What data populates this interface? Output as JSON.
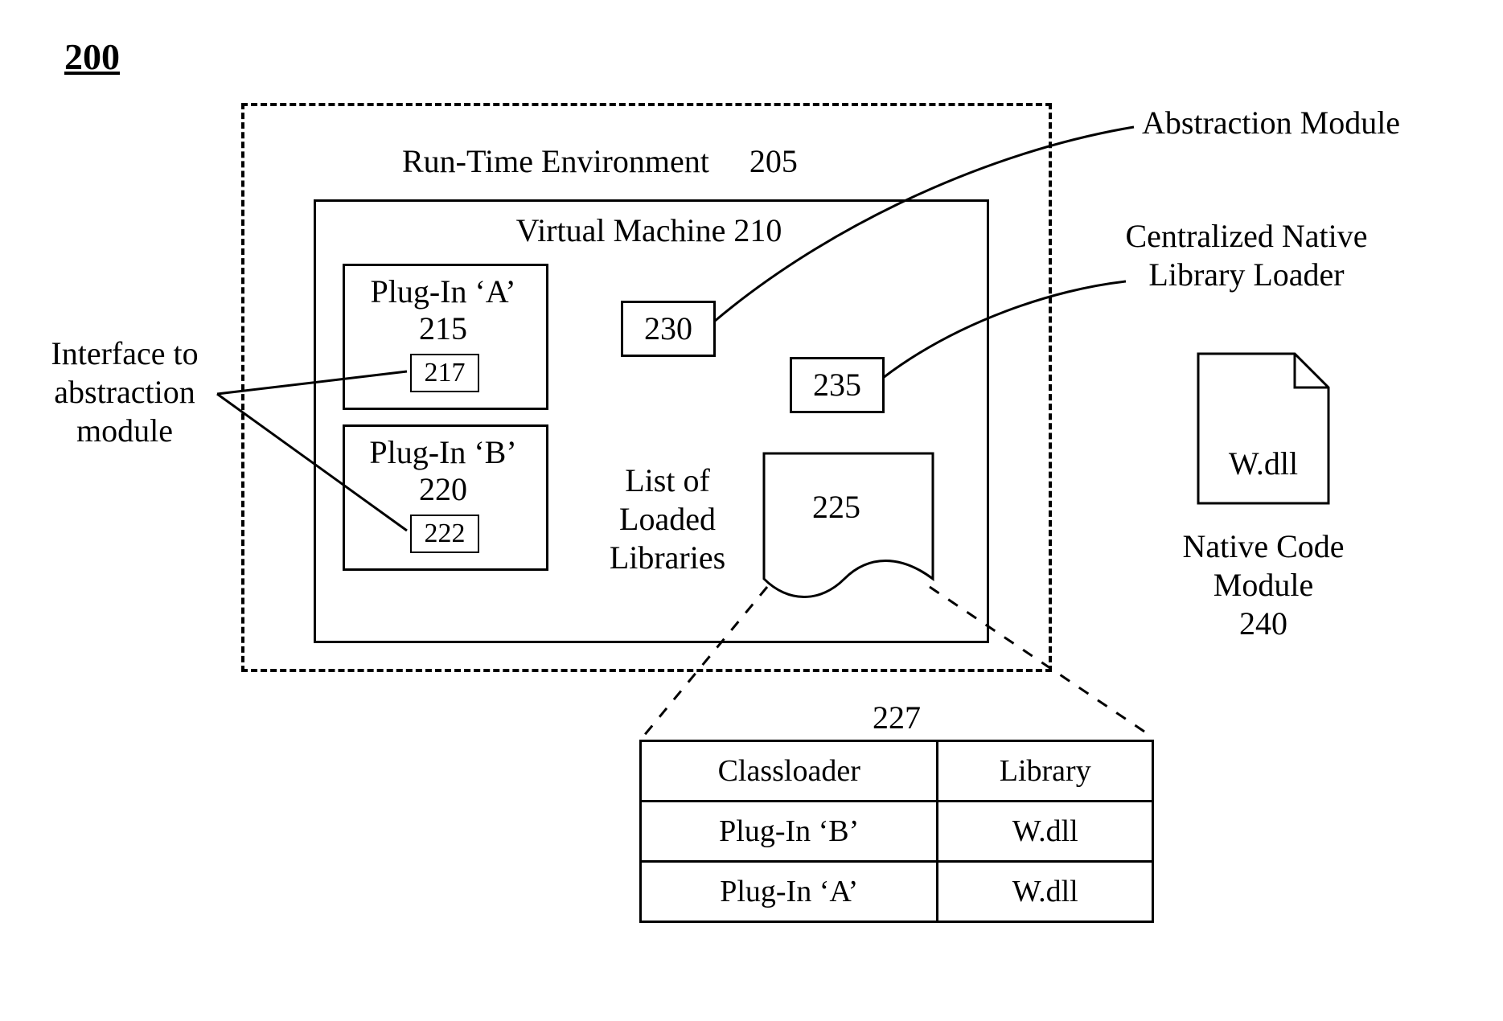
{
  "figure_number": "200",
  "runtime_env": {
    "label": "Run-Time Environment",
    "ref": "205"
  },
  "vm": {
    "label": "Virtual Machine",
    "ref": "210"
  },
  "plugin_a": {
    "label": "Plug-In ‘A’",
    "ref": "215",
    "inner_ref": "217"
  },
  "plugin_b": {
    "label": "Plug-In ‘B’",
    "ref": "220",
    "inner_ref": "222"
  },
  "box_230": "230",
  "box_235": "235",
  "box_225": "225",
  "list_label_l1": "List of",
  "list_label_l2": "Loaded",
  "list_label_l3": "Libraries",
  "table_ref": "227",
  "table": {
    "h1": "Classloader",
    "h2": "Library",
    "r1c1": "Plug-In ‘B’",
    "r1c2": "W.dll",
    "r2c1": "Plug-In ‘A’",
    "r2c2": "W.dll"
  },
  "callout_left_l1": "Interface to",
  "callout_left_l2": "abstraction",
  "callout_left_l3": "module",
  "callout_top_right": "Abstraction Module",
  "callout_mid_right_l1": "Centralized Native",
  "callout_mid_right_l2": "Library Loader",
  "file_label": "W.dll",
  "native_module_l1": "Native Code",
  "native_module_l2": "Module",
  "native_module_ref": "240"
}
